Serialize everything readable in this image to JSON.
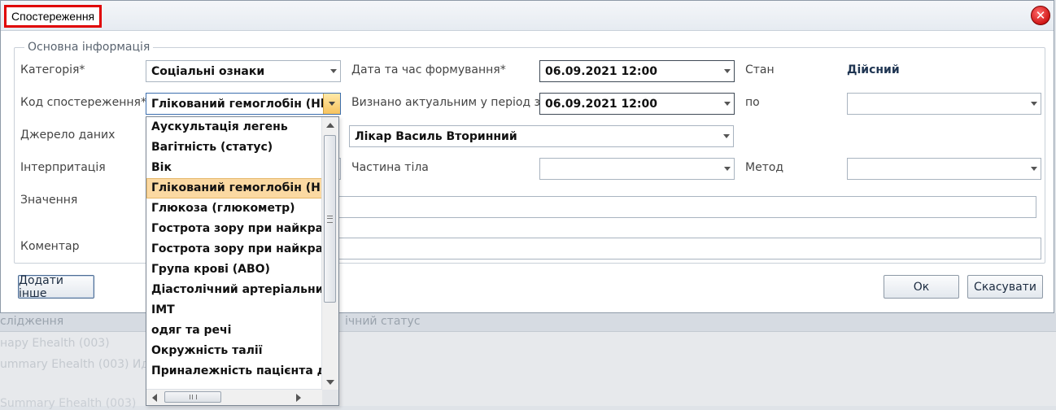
{
  "window": {
    "title": "Спостереження"
  },
  "group": {
    "legend": "Основна інформація"
  },
  "fields": {
    "category_label": "Категорія*",
    "category_value": "Соціальні ознаки",
    "code_label": "Код спостереження*",
    "code_value": "Глікований гемоглобін (HbA",
    "source_label": "Джерело даних",
    "source_value": "Лікар Василь Вторинний",
    "interp_label": "Інтерпритація",
    "value_label": "Значення",
    "comment_label": "Коментар",
    "formed_label": "Дата та час формування*",
    "formed_value": "06.09.2021 12:00",
    "actual_label": "Визнано актуальним у період з*",
    "actual_value": "06.09.2021 12:00",
    "bodypart_label": "Частина тіла",
    "state_label": "Стан",
    "state_value": "Дійсний",
    "to_label": "по",
    "method_label": "Метод"
  },
  "buttons": {
    "add_other": "Додати інше",
    "ok": "Ок",
    "cancel": "Скасувати"
  },
  "dropdown": {
    "items": [
      "Аускультація легень",
      "Вагітність (статус)",
      "Вік",
      "Глікований гемоглобін (HbA",
      "Глюкоза (глюкометр)",
      "Гострота зору при найкращі",
      "Гострота зору при найкращі",
      "Група крові (АВО)",
      "Діастолічний артеріальний т",
      "ІМТ",
      "одяг та речі",
      "Окружність талії",
      "Приналежність пацієнта до г"
    ],
    "selected_index": 3
  },
  "background": {
    "header_left": "слідження",
    "header_right": "ічний статус",
    "row1": "нару Ehealth (003)",
    "row2": "ummary Ehealth (003) Ид",
    "row3": "Summary Ehealth (003)"
  }
}
